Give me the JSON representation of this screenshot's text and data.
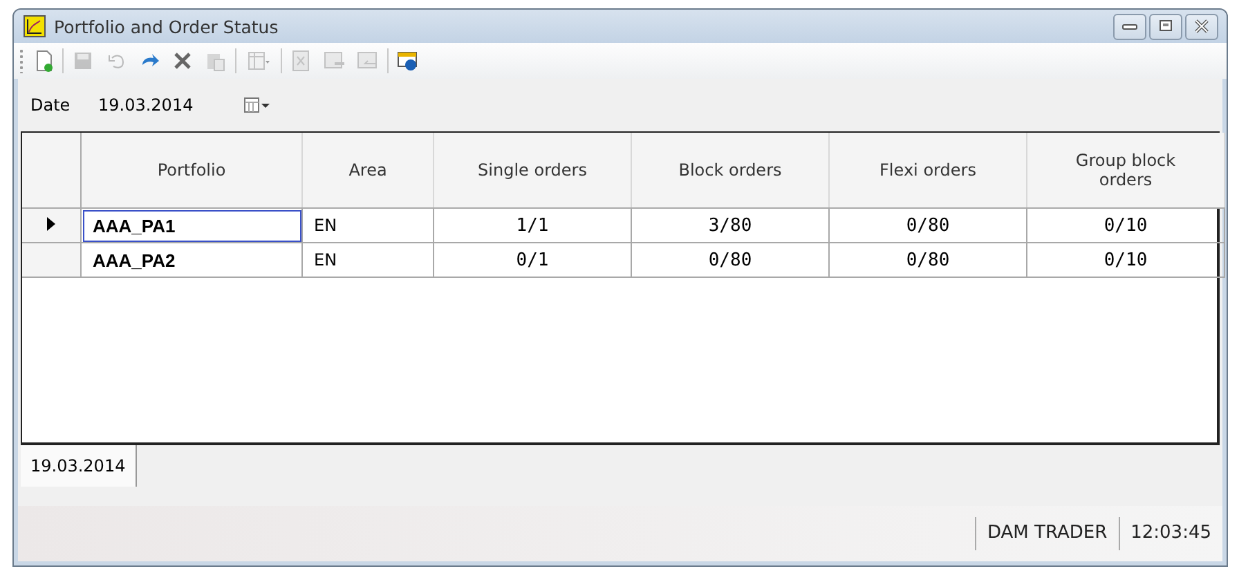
{
  "window": {
    "title": "Portfolio and Order Status"
  },
  "toolbar": [
    [
      {
        "kind": "new",
        "disabled": false
      }
    ],
    [
      {
        "kind": "save",
        "disabled": true
      },
      {
        "kind": "undo",
        "disabled": true
      },
      {
        "kind": "redo",
        "disabled": false
      },
      {
        "kind": "delete",
        "disabled": false
      },
      {
        "kind": "paste",
        "disabled": true
      }
    ],
    [
      {
        "kind": "table",
        "disabled": true
      }
    ],
    [
      {
        "kind": "export",
        "disabled": true
      },
      {
        "kind": "import",
        "disabled": true
      },
      {
        "kind": "back",
        "disabled": true
      }
    ],
    [
      {
        "kind": "help",
        "disabled": false
      }
    ]
  ],
  "date_field": {
    "label": "Date",
    "value": "19.03.2014"
  },
  "table": {
    "columns": [
      "Portfolio",
      "Area",
      "Single orders",
      "Block orders",
      "Flexi orders",
      "Group block orders"
    ],
    "rows": [
      {
        "selected": true,
        "cells": [
          "AAA_PA1",
          "EN",
          "1/1",
          "3/80",
          "0/80",
          "0/10"
        ]
      },
      {
        "selected": false,
        "cells": [
          "AAA_PA2",
          "EN",
          "0/1",
          "0/80",
          "0/80",
          "0/10"
        ]
      }
    ]
  },
  "tabs": [
    {
      "label": "19.03.2014",
      "selected": true
    }
  ],
  "status_bar": [
    "DAM TRADER",
    "12:03:45"
  ]
}
